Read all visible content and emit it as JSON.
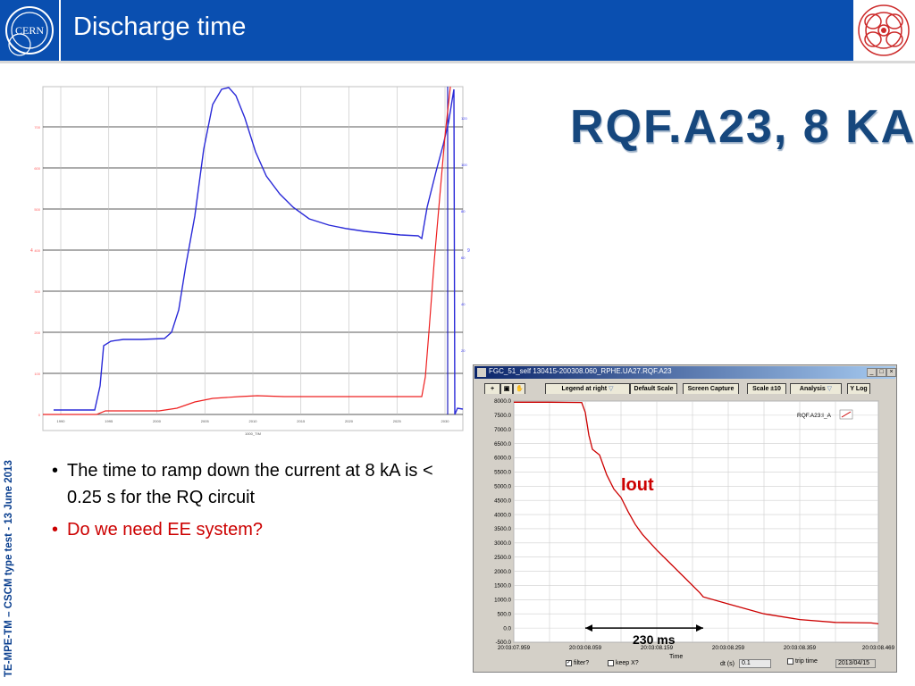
{
  "slide": {
    "title": "Discharge time",
    "side_text": "TE-MPE-TM – CSCM type test - 13 June 2013",
    "big_title": "RQF.A23, 8 KA",
    "logo_text": "CERN",
    "bullets": [
      {
        "text": "The time to ramp down the current at 8 kA is < 0.25 s for the RQ circuit",
        "color": "#000000"
      },
      {
        "text": "Do we need EE system?",
        "color": "#cc0000"
      }
    ],
    "colors": {
      "header": "#0a4fb0",
      "accent_red": "#cc0000",
      "title_blue": "#16477d"
    }
  },
  "left_plot": {
    "y_ticks_left": [
      "0",
      "100",
      "200",
      "300",
      "400",
      "500",
      "600",
      "700"
    ],
    "y_ticks_right": [
      "20",
      "40",
      "60",
      "80",
      "100",
      "120"
    ],
    "x_ticks": [
      "1990",
      "1995",
      "2000",
      "2005",
      "2010",
      "2015",
      "2020",
      "2025",
      "2030"
    ],
    "xlabel": "1000_TIM",
    "left_axis_label": "4",
    "right_axis_label": "9"
  },
  "chart_data": {
    "type": "line",
    "title": "",
    "xlabel": "Time",
    "ylabel": "",
    "x_ticks": [
      "20:03:07.959",
      "20:03:08.059",
      "20:03:08.159",
      "20:03:08.259",
      "20:03:08.359",
      "20:03:08.469"
    ],
    "y_ticks": [
      "8000.0",
      "7500.0",
      "7000.0",
      "6500.0",
      "6000.0",
      "5500.0",
      "5000.0",
      "4500.0",
      "4000.0",
      "3500.0",
      "3000.0",
      "2500.0",
      "2000.0",
      "1500.0",
      "1000.0",
      "500.0",
      "0.0",
      "-500.0"
    ],
    "xlim": [
      0,
      0.51
    ],
    "ylim": [
      -500,
      8000
    ],
    "grid": true,
    "legend_position": "top-right",
    "series": [
      {
        "name": "RQF.A23:I_A",
        "color": "#cc0000",
        "x": [
          0,
          0.05,
          0.095,
          0.1,
          0.105,
          0.11,
          0.12,
          0.13,
          0.14,
          0.15,
          0.16,
          0.17,
          0.18,
          0.2,
          0.22,
          0.24,
          0.26,
          0.265,
          0.3,
          0.35,
          0.4,
          0.45,
          0.5,
          0.51
        ],
        "y": [
          7960,
          7960,
          7950,
          7600,
          6800,
          6300,
          6100,
          5400,
          4900,
          4600,
          4100,
          3650,
          3300,
          2750,
          2250,
          1750,
          1250,
          1100,
          850,
          500,
          300,
          200,
          180,
          150
        ]
      }
    ],
    "annotations": [
      "Iout",
      "230 ms"
    ]
  },
  "fgc_window": {
    "title": "FGC_51_self  130415-200308.060_RPHE.UA27.RQF.A23",
    "toolbar": {
      "legend": "Legend at right",
      "default_scale": "Default Scale",
      "screen_capture": "Screen Capture",
      "scale": "Scale ±10",
      "analysis": "Analysis",
      "ylog": "Y Log"
    },
    "legend_label": "RQF.A23:I_A",
    "annotation_iout": "Iout",
    "annotation_duration": "230 ms",
    "footer": {
      "filter_label": "filter?",
      "keepx_label": "keep X?",
      "time_label": "Time",
      "dt_label": "dt (s)",
      "dt_value": "0.1",
      "trip_time_label": "trip time",
      "date_value": "2013/04/15"
    }
  }
}
